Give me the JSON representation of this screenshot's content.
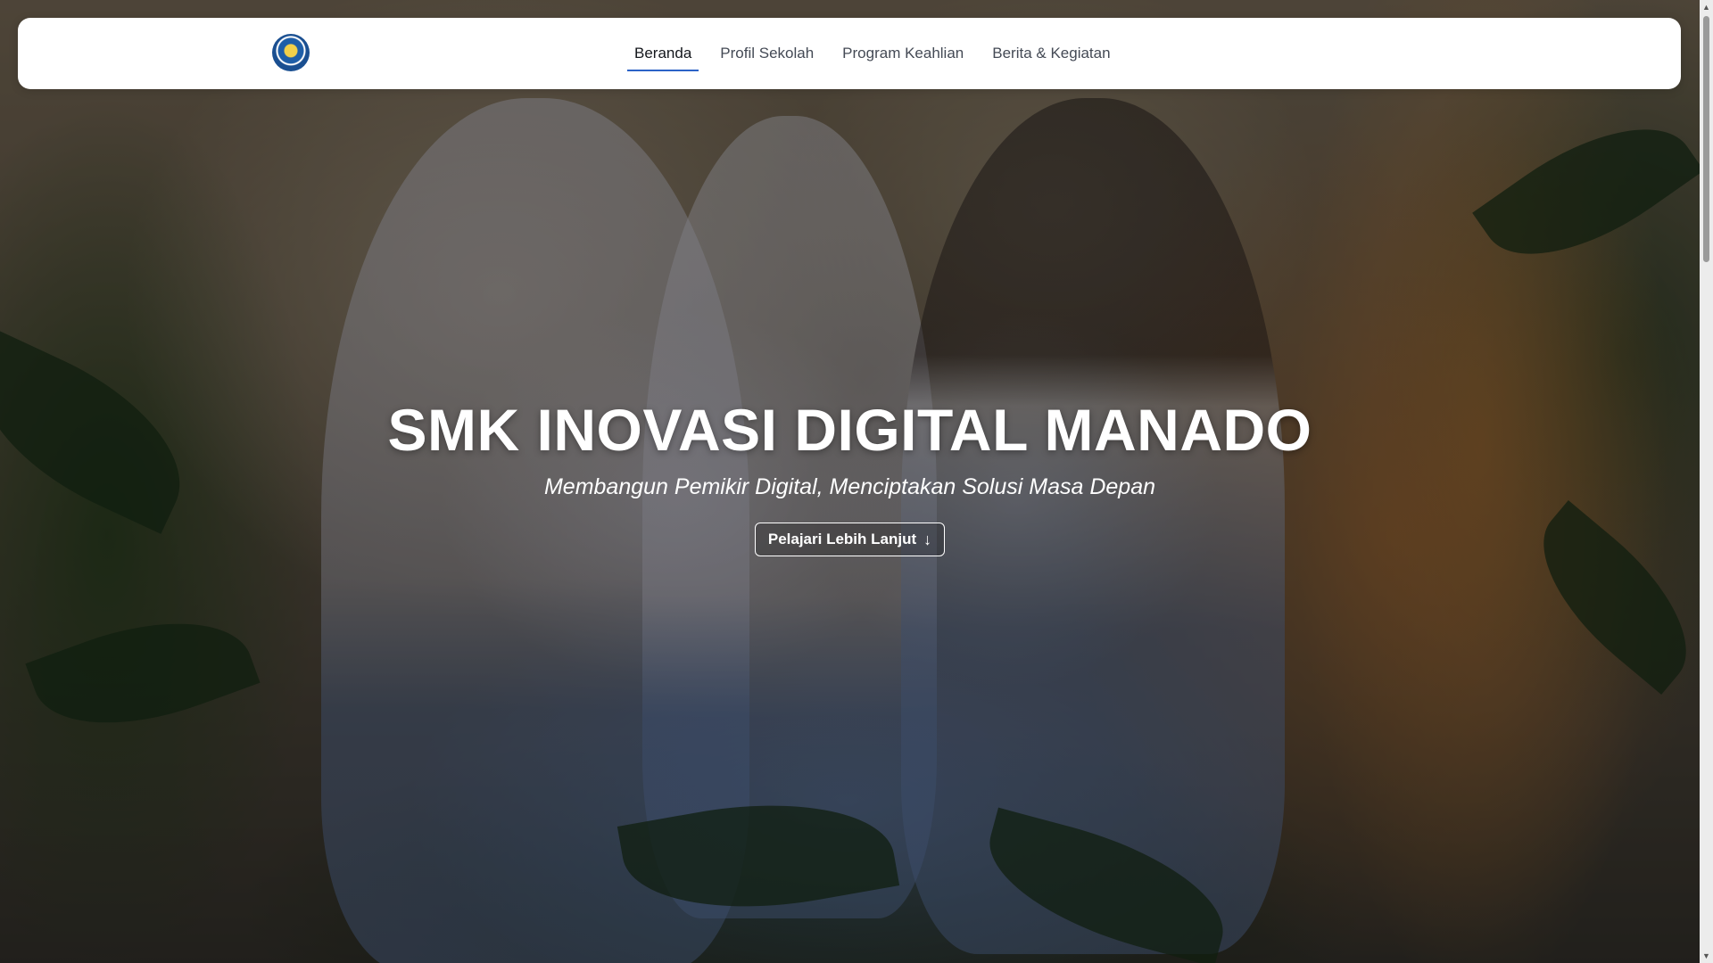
{
  "navbar": {
    "logo_icon": "tut-wuri-handayani-logo",
    "links": [
      {
        "label": "Beranda",
        "active": true
      },
      {
        "label": "Profil Sekolah",
        "active": false
      },
      {
        "label": "Program Keahlian",
        "active": false
      },
      {
        "label": "Berita & Kegiatan",
        "active": false
      }
    ],
    "active_color": "#2c63c7"
  },
  "hero": {
    "title": "SMK INOVASI DIGITAL MANADO",
    "subtitle": "Membangun Pemikir Digital, Menciptakan Solusi Masa Depan",
    "cta_label": "Pelajari Lebih Lanjut",
    "cta_icon": "arrow-down-icon",
    "cta_arrow": "↓"
  },
  "scrollbar": {
    "up_glyph": "▲",
    "down_glyph": "▼"
  }
}
